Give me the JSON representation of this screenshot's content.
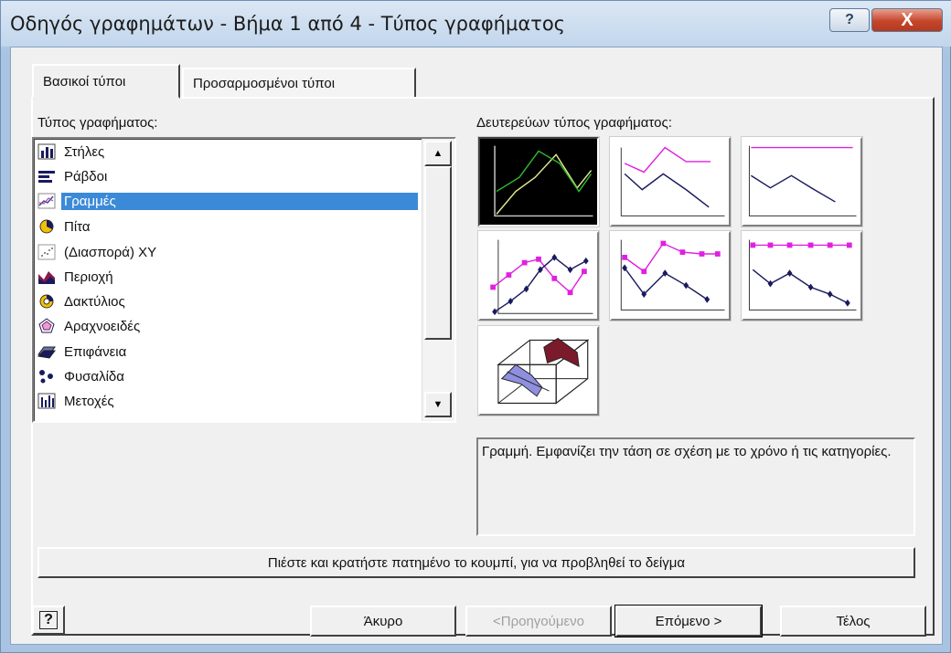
{
  "window": {
    "title": "Οδηγός γραφημάτων - Βήμα 1 από 4 - Τύπος γραφήματος",
    "help_glyph": "?",
    "close_glyph": "X"
  },
  "tabs": [
    {
      "label": "Βασικοί τύποι",
      "selected": true
    },
    {
      "label": "Προσαρμοσμένοι τύποι",
      "selected": false
    }
  ],
  "chart_type": {
    "label": "Τύπος γραφήματος:",
    "items": [
      {
        "label": "Στήλες",
        "icon": "column-chart-icon"
      },
      {
        "label": "Ράβδοι",
        "icon": "bar-chart-icon"
      },
      {
        "label": "Γραμμές",
        "icon": "line-chart-icon",
        "selected": true
      },
      {
        "label": "Πίτα",
        "icon": "pie-chart-icon"
      },
      {
        "label": "(Διασπορά) XY",
        "icon": "scatter-chart-icon"
      },
      {
        "label": "Περιοχή",
        "icon": "area-chart-icon"
      },
      {
        "label": "Δακτύλιος",
        "icon": "doughnut-chart-icon"
      },
      {
        "label": "Αραχνοειδές",
        "icon": "radar-chart-icon"
      },
      {
        "label": "Επιφάνεια",
        "icon": "surface-chart-icon"
      },
      {
        "label": "Φυσαλίδα",
        "icon": "bubble-chart-icon"
      },
      {
        "label": "Μετοχές",
        "icon": "stock-chart-icon"
      }
    ]
  },
  "subtype": {
    "label": "Δευτερεύων τύπος γραφήματος:",
    "items": [
      {
        "name": "line",
        "selected": true
      },
      {
        "name": "stacked-line"
      },
      {
        "name": "100-stacked-line"
      },
      {
        "name": "line-with-markers"
      },
      {
        "name": "stacked-line-with-markers"
      },
      {
        "name": "100-stacked-line-with-markers"
      },
      {
        "name": "3d-line"
      }
    ],
    "description": "Γραμμή. Εμφανίζει την τάση σε σχέση με το χρόνο ή τις κατηγορίες."
  },
  "preview_button": "Πιέστε και κρατήστε πατημένο το κουμπί, για να προβληθεί το δείγμα",
  "buttons": {
    "help_glyph": "?",
    "cancel": "Άκυρο",
    "back": "<Προηγούμενο",
    "next": "Επόμενο >",
    "finish": "Τέλος"
  },
  "colors": {
    "selection": "#3b8ad8",
    "magenta": "#e020e0",
    "navy": "#1a1a5e",
    "green": "#2fb82f",
    "yellow": "#e8e890",
    "maroon": "#7a1a2a",
    "lavender": "#8f8fe0"
  }
}
